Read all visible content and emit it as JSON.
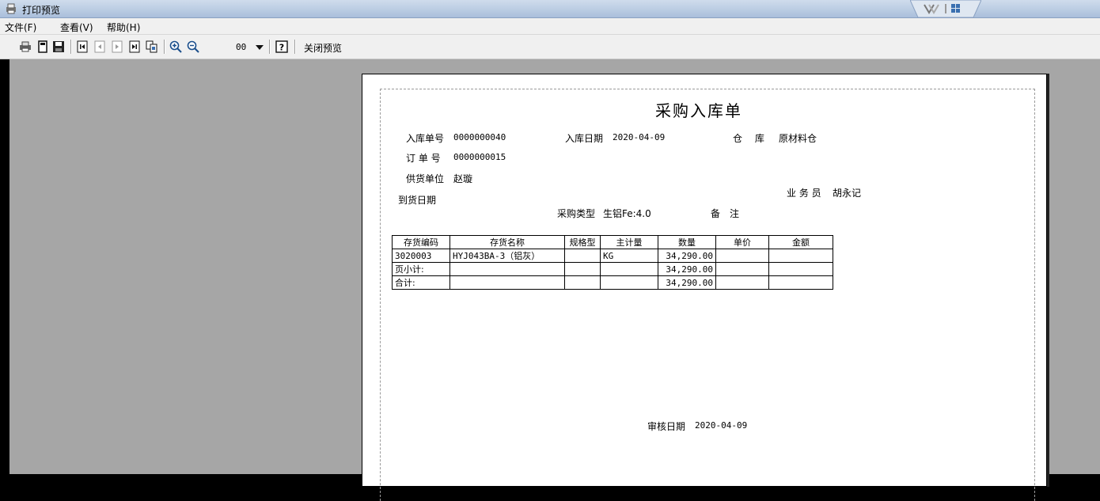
{
  "window": {
    "title": "打印预览"
  },
  "menu": {
    "items": [
      "文件(F)",
      "查看(V)",
      "帮助(H)"
    ]
  },
  "toolbar": {
    "zoom_value": "00",
    "close_label": "关闭预览"
  },
  "document": {
    "title": "采购入库单",
    "receipt_no_label": "入库单号",
    "receipt_no": "0000000040",
    "receipt_date_label": "入库日期",
    "receipt_date": "2020-04-09",
    "warehouse_label": "仓　 库",
    "warehouse": "原材料仓",
    "order_no_label": "订 单 号",
    "order_no": "0000000015",
    "supplier_label": "供货单位",
    "supplier": "赵璇",
    "salesperson_label": "业 务 员",
    "salesperson": "胡永记",
    "arrival_date_label": "到货日期",
    "purchase_type_label": "采购类型",
    "purchase_type": "生铝Fe:4.0",
    "remark_label": "备　注",
    "audit_date_label": "审核日期",
    "audit_date": "2020-04-09",
    "table": {
      "headers": [
        "存货编码",
        "存货名称",
        "规格型",
        "主计量",
        "数量",
        "单价",
        "金额"
      ],
      "rows": [
        [
          "3020003",
          "HYJ043BA-3（铝灰）",
          "",
          "KG",
          "34,290.00",
          "",
          ""
        ],
        [
          "页小计:",
          "",
          "",
          "",
          "34,290.00",
          "",
          ""
        ],
        [
          "合计:",
          "",
          "",
          "",
          "34,290.00",
          "",
          ""
        ]
      ]
    }
  },
  "icons": [
    "printer-icon",
    "page-setup-icon",
    "save-icon",
    "first-page-icon",
    "prev-page-icon",
    "next-page-icon",
    "last-page-icon",
    "multi-page-icon",
    "zoom-in-icon",
    "zoom-out-icon",
    "dropdown-arrow-icon",
    "help-icon"
  ]
}
